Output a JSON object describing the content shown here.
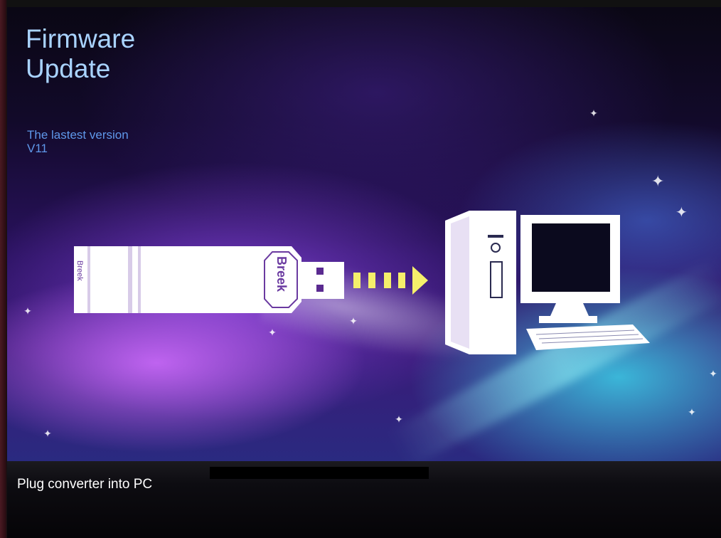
{
  "header": {
    "title": "Firmware Update",
    "version_label": "The lastest version",
    "version_value": "V11"
  },
  "illustration": {
    "usb_brand": "Breek",
    "usb_brand_end": "Breek",
    "arrow_color": "#f5ef6b",
    "items": [
      "usb-converter-icon",
      "usb-plug-icon",
      "arrow-right-icon",
      "desktop-pc-icon"
    ]
  },
  "footer": {
    "status": "Plug converter into PC"
  },
  "colors": {
    "title": "#a9d3ff",
    "version": "#5f98ea",
    "status_text": "#ffffff"
  }
}
